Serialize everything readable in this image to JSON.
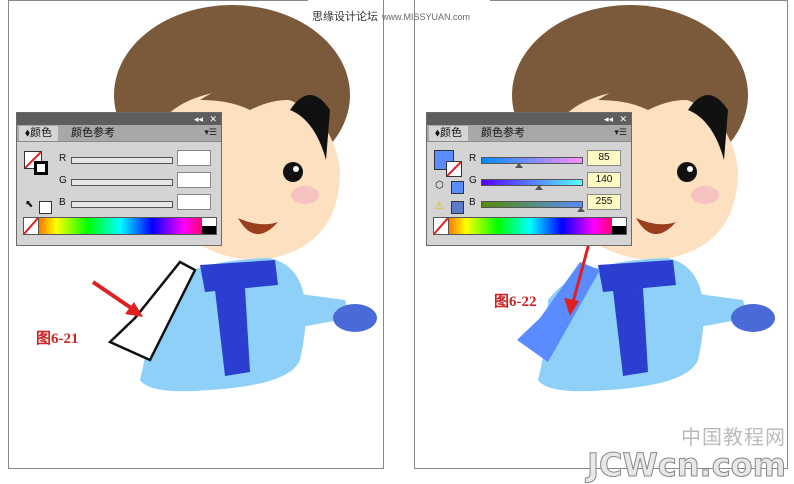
{
  "watermark_top": {
    "text": "思缘设计论坛",
    "url": "www.MISSYUAN.com"
  },
  "logo": {
    "cn": "中国教程网",
    "en": "JCWcn.com"
  },
  "figures": {
    "left_label": "图6-21",
    "right_label": "图6-22"
  },
  "panel_left": {
    "tab_active": "颜色",
    "tab_inactive": "颜色参考",
    "channels": [
      {
        "label": "R",
        "value": ""
      },
      {
        "label": "G",
        "value": ""
      },
      {
        "label": "B",
        "value": ""
      }
    ]
  },
  "panel_right": {
    "tab_active": "颜色",
    "tab_inactive": "颜色参考",
    "fill_color": "#5a8cff",
    "channels": [
      {
        "label": "R",
        "value": "85"
      },
      {
        "label": "G",
        "value": "140"
      },
      {
        "label": "B",
        "value": "255"
      }
    ]
  },
  "colors": {
    "accent_red": "#cc2222",
    "hair": "#7a5a3a",
    "skin": "#fde0bf",
    "coat": "#8fd0f8",
    "scarf": "#2a3fcf"
  },
  "icons": [
    "collapse-icon",
    "close-icon",
    "menu-icon",
    "swap-icon",
    "cube-icon",
    "warning-icon",
    "arrow-icon"
  ]
}
